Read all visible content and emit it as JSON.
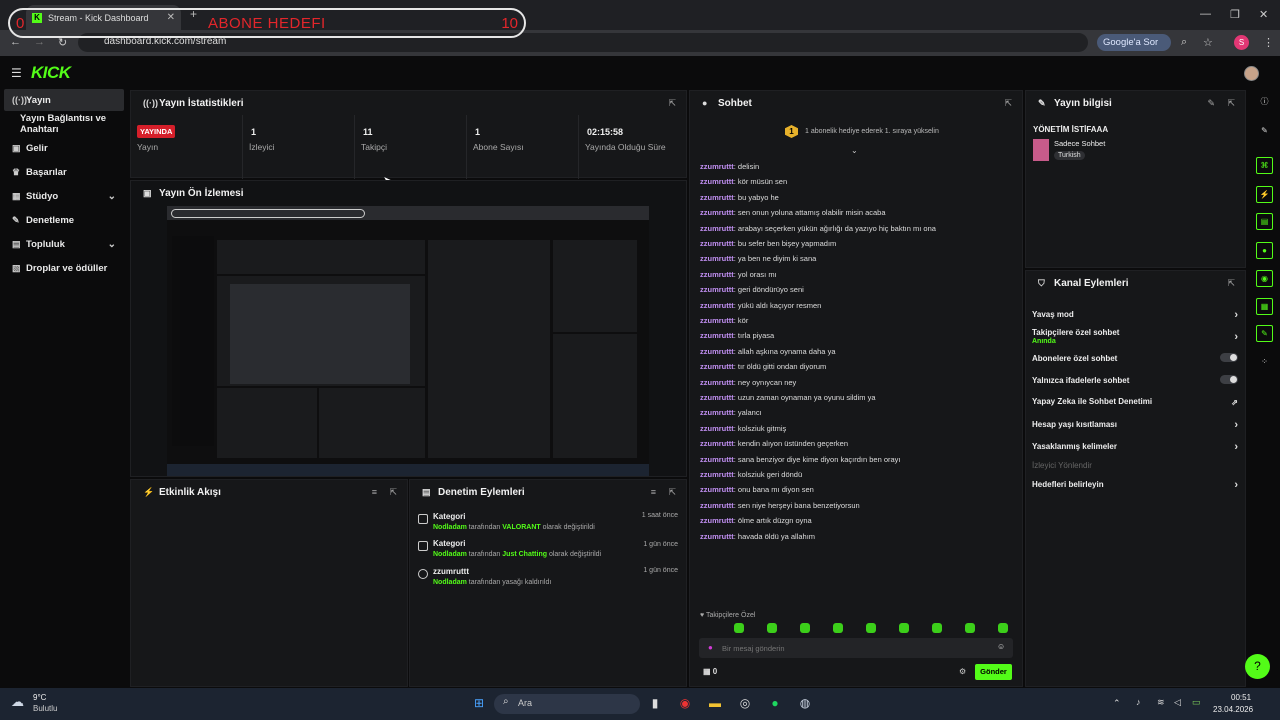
{
  "browser": {
    "tab_title": "Stream - Kick Dashboard",
    "url": "dashboard.kick.com/stream",
    "google_sor": "Google'a Sor",
    "profile_initial": "S"
  },
  "goal_overlay": {
    "left": "0",
    "title": "ABONE HEDEFI",
    "right": "10"
  },
  "kick": {
    "logo": "KICK"
  },
  "sidebar": {
    "items": [
      {
        "label": "Yayın",
        "icon": "stream-icon"
      },
      {
        "label": "Yayın Bağlantısı ve Anahtarı"
      },
      {
        "label": "Gelir",
        "icon": "money-icon"
      },
      {
        "label": "Başarılar",
        "icon": "trophy-icon"
      },
      {
        "label": "Stüdyo",
        "icon": "studio-icon"
      },
      {
        "label": "Denetleme",
        "icon": "wrench-icon"
      },
      {
        "label": "Topluluk",
        "icon": "community-icon"
      },
      {
        "label": "Droplar ve ödüller",
        "icon": "gift-icon"
      }
    ]
  },
  "stats": {
    "title": "Yayın İstatistikleri",
    "items": [
      {
        "value": "YAYINDA",
        "label": "Yayın"
      },
      {
        "value": "1",
        "label": "İzleyici"
      },
      {
        "value": "11",
        "label": "Takipçi"
      },
      {
        "value": "1",
        "label": "Abone Sayısı"
      },
      {
        "value": "02:15:58",
        "label": "Yayında Olduğu Süre"
      }
    ]
  },
  "preview": {
    "title": "Yayın Ön İzlemesi"
  },
  "activity": {
    "title": "Etkinlik Akışı"
  },
  "mod_actions": {
    "title": "Denetim Eylemleri",
    "items": [
      {
        "title": "Kategori",
        "by": "Nodladam",
        "text1": "tarafından",
        "value": "VALORANT",
        "text2": "olarak değiştirildi",
        "time": "1 saat önce"
      },
      {
        "title": "Kategori",
        "by": "Nodladam",
        "text1": "tarafından",
        "value": "Just Chatting",
        "text2": "olarak değiştirildi",
        "time": "1 gün önce"
      },
      {
        "title": "zzumruttt",
        "by": "Nodladam",
        "text1": "tarafından yasağı kaldırıldı",
        "value": "",
        "text2": "",
        "time": "1 gün önce"
      }
    ]
  },
  "chat": {
    "title": "Sohbet",
    "pinned_rank": "1",
    "pinned": "1 abonelik hediye ederek 1. sıraya yükselin",
    "messages": [
      {
        "user": "zzumruttt",
        "text": "delisin"
      },
      {
        "user": "zzumruttt",
        "text": "kör müsün sen"
      },
      {
        "user": "zzumruttt",
        "text": "bu yabyo he"
      },
      {
        "user": "zzumruttt",
        "text": "sen onun yoluna attamış olabilir misin acaba"
      },
      {
        "user": "zzumruttt",
        "text": "arabayı seçerken yükün ağırlığı da yazıyo hiç baktın mı ona"
      },
      {
        "user": "zzumruttt",
        "text": "bu sefer ben bişey yapmadım"
      },
      {
        "user": "zzumruttt",
        "text": "ya ben ne diyim ki sana"
      },
      {
        "user": "zzumruttt",
        "text": "yol orası mı"
      },
      {
        "user": "zzumruttt",
        "text": "geri döndürüyo seni"
      },
      {
        "user": "zzumruttt",
        "text": "yükü aldı kaçıyor resmen"
      },
      {
        "user": "zzumruttt",
        "text": "kör"
      },
      {
        "user": "zzumruttt",
        "text": "tırla piyasa"
      },
      {
        "user": "zzumruttt",
        "text": "allah aşkına oynama daha ya"
      },
      {
        "user": "zzumruttt",
        "text": "tır öldü gitti ondan diyorum"
      },
      {
        "user": "zzumruttt",
        "text": "ney oynıycan ney"
      },
      {
        "user": "zzumruttt",
        "text": "uzun zaman oynaman ya oyunu sildim ya"
      },
      {
        "user": "zzumruttt",
        "text": "yalancı"
      },
      {
        "user": "zzumruttt",
        "text": "kolsziuk gitmiş"
      },
      {
        "user": "zzumruttt",
        "text": "kendin alıyon üstünden geçerken"
      },
      {
        "user": "zzumruttt",
        "text": "sana benziyor diye kime diyon kaçırdın ben orayı"
      },
      {
        "user": "zzumruttt",
        "text": "kolsziuk geri döndü"
      },
      {
        "user": "zzumruttt",
        "text": "onu bana mı diyon sen"
      },
      {
        "user": "zzumruttt",
        "text": "sen niye herşeyi bana benzetiyorsun"
      },
      {
        "user": "zzumruttt",
        "text": "ölme artık düzgn oyna"
      },
      {
        "user": "zzumruttt",
        "text": "havada öldü ya allahım"
      }
    ],
    "followers_only": "Takipçilere Özel",
    "input_placeholder": "Bir mesaj gönderin",
    "points": "0",
    "send": "Gönder"
  },
  "stream_info": {
    "title": "Yayın bilgisi",
    "stream_title": "YÖNETİM İSTİFAAA",
    "category": "Sadece Sohbet",
    "tag": "Turkish"
  },
  "channel_actions": {
    "title": "Kanal Eylemleri",
    "items": [
      {
        "label": "Yavaş mod",
        "kind": "arrow"
      },
      {
        "label": "Takipçilere özel sohbet",
        "sub": "Anında",
        "kind": "arrow"
      },
      {
        "label": "Abonelere özel sohbet",
        "kind": "toggle"
      },
      {
        "label": "Yalnızca ifadelerle sohbet",
        "kind": "toggle"
      },
      {
        "label": "Yapay Zeka ile Sohbet Denetimi",
        "kind": "external"
      },
      {
        "label": "Hesap yaşı kısıtlaması",
        "kind": "arrow"
      },
      {
        "label": "Yasaklanmış kelimeler",
        "kind": "arrow"
      },
      {
        "label": "İzleyici Yönlendir",
        "kind": "disabled"
      },
      {
        "label": "Hedefleri belirleyin",
        "kind": "arrow"
      }
    ]
  },
  "taskbar": {
    "weather_temp": "9°C",
    "weather_desc": "Bulutlu",
    "search": "Ara",
    "time": "00:51",
    "date": "23.04.2026"
  }
}
